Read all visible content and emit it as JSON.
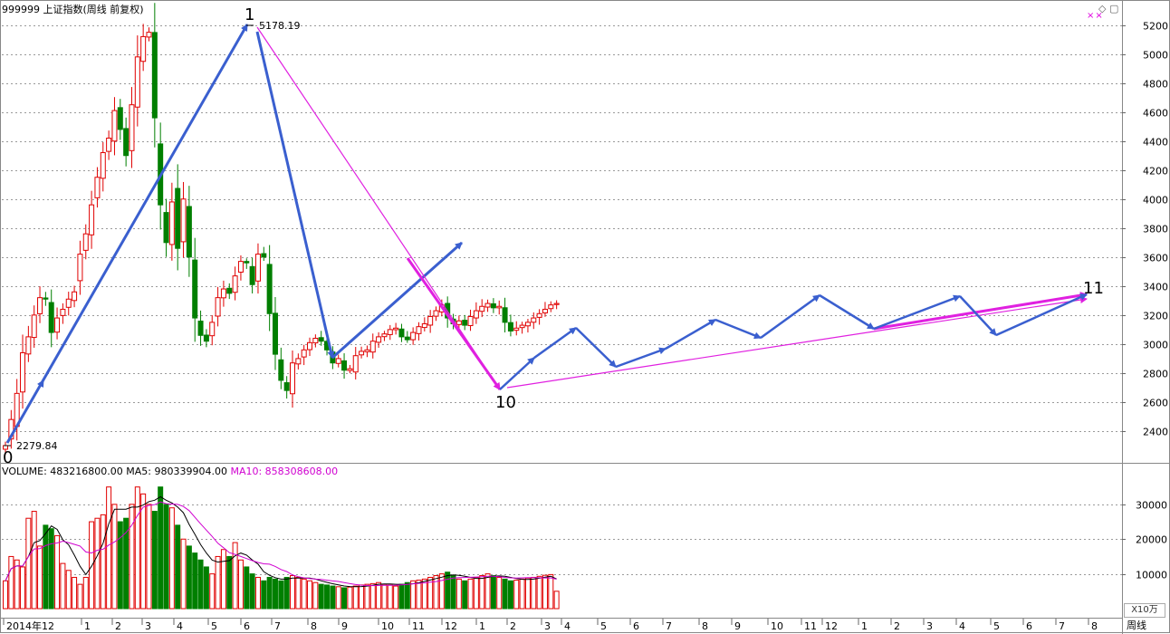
{
  "header": {
    "title": "999999 上证指数(周线 前复权)"
  },
  "volume_header": {
    "volume": "VOLUME: 483216800.00",
    "ma5": "MA5: 980339904.00",
    "ma10": "MA10: 858308608.00"
  },
  "window_icons": "◇ ▢",
  "marker_xx": "××",
  "volume_unit": "X10万",
  "period_tab": "周线",
  "colors": {
    "up": "#e00000",
    "down": "#007f00",
    "wave_blue": "#3a5fcf",
    "wave_magenta": "#e020e0",
    "ma5": "#000000",
    "ma10": "#d000d0",
    "grid": "#9a9a9a"
  },
  "chart_data": {
    "type": "candlestick",
    "price_axis": {
      "ticks": [
        2400,
        2600,
        2800,
        3000,
        3200,
        3400,
        3600,
        3800,
        4000,
        4200,
        4400,
        4600,
        4800,
        5000,
        5200
      ],
      "range": [
        2200,
        5260
      ]
    },
    "volume_axis": {
      "ticks": [
        10000,
        20000,
        30000
      ],
      "range": [
        0,
        37000
      ]
    },
    "x_labels": [
      "2014年12",
      "1",
      "2",
      "3",
      "4",
      "5",
      "6",
      "7",
      "8",
      "9",
      "10",
      "11",
      "12",
      "1",
      "2",
      "3",
      "4",
      "5",
      "6",
      "7",
      "8",
      "9",
      "10",
      "11",
      "12",
      "1",
      "2",
      "3",
      "4",
      "5",
      "6",
      "7",
      "8"
    ],
    "annotations": [
      {
        "text": "2279.84",
        "value": 2279.84
      },
      {
        "text": "5178.19",
        "value": 5178.19
      }
    ],
    "wave_labels": [
      "0",
      "1",
      "10",
      "11"
    ],
    "close_path": [
      2300,
      2480,
      2660,
      2940,
      3050,
      3200,
      3320,
      3310,
      3080,
      3180,
      3240,
      3310,
      3360,
      3620,
      3760,
      3960,
      4150,
      4320,
      4420,
      4610,
      4480,
      4300,
      4650,
      4980,
      5120,
      5150,
      4560,
      3960,
      3700,
      3980,
      3660,
      4000,
      3600,
      3180,
      3060,
      3020,
      3150,
      3320,
      3380,
      3350,
      3470,
      3570,
      3560,
      3410,
      3620,
      3600,
      3210,
      2930,
      2750,
      2680,
      2870,
      2900,
      2960,
      3010,
      3040,
      3020,
      2960,
      2870,
      2900,
      2820,
      2830,
      2920,
      2950,
      2960,
      3020,
      3050,
      3070,
      3100,
      3110,
      3050,
      3030,
      3080,
      3120,
      3140,
      3190,
      3230,
      3270,
      3180,
      3140,
      3160,
      3130,
      3190,
      3230,
      3260,
      3280,
      3250,
      3260,
      3150,
      3090,
      3110,
      3130,
      3150,
      3180,
      3210,
      3240,
      3270,
      3280
    ],
    "volume_path": [
      8000,
      15000,
      14000,
      12000,
      26000,
      28000,
      18000,
      24000,
      23000,
      21000,
      13000,
      11000,
      9000,
      7000,
      9000,
      25000,
      26000,
      27000,
      35000,
      30000,
      25000,
      26000,
      30000,
      35000,
      33000,
      30000,
      28000,
      35000,
      30000,
      29000,
      24000,
      20000,
      18000,
      16000,
      14000,
      12000,
      10000,
      15000,
      17000,
      15000,
      19000,
      14000,
      12000,
      10000,
      9000,
      8000,
      9000,
      8500,
      8000,
      9000,
      9500,
      9000,
      8500,
      8000,
      7500,
      7000,
      6800,
      6500,
      6300,
      6000,
      6200,
      6500,
      6800,
      7000,
      7200,
      7500,
      7000,
      6800,
      6500,
      7000,
      7500,
      8000,
      8200,
      8500,
      9000,
      9500,
      10000,
      10500,
      9500,
      8500,
      8000,
      8500,
      9000,
      9500,
      10000,
      9500,
      9000,
      8500,
      8000,
      8200,
      8500,
      8800,
      9000,
      9300,
      9600,
      9800,
      5000
    ]
  }
}
